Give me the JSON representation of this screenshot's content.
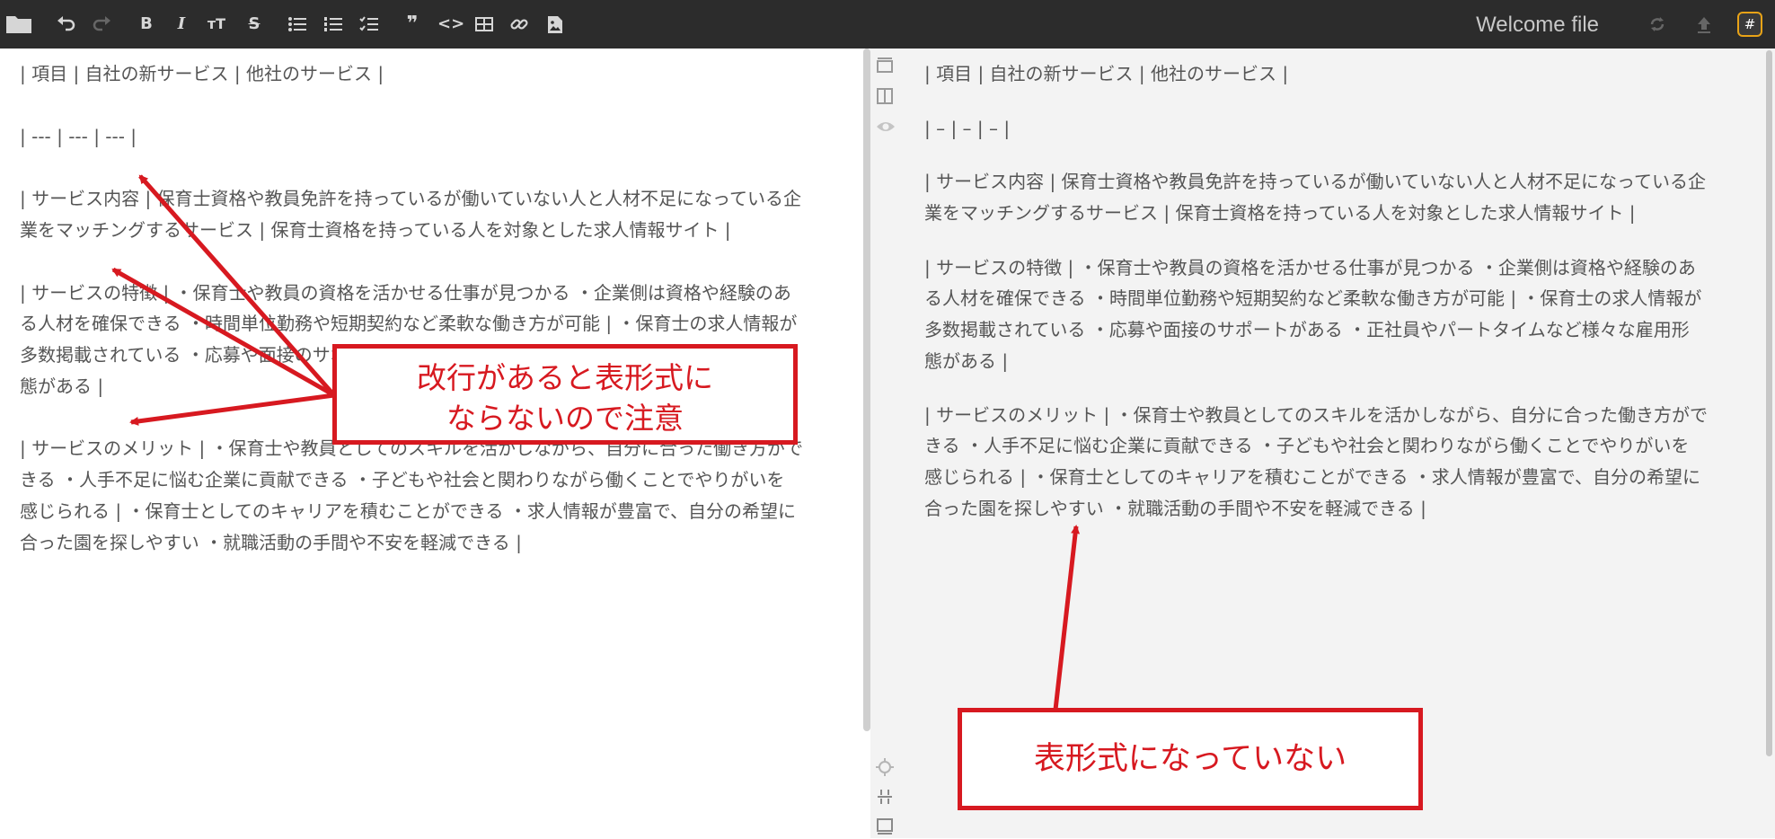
{
  "toolbar": {
    "title": "Welcome file",
    "icons": [
      "folder-icon",
      "undo-icon",
      "redo-icon",
      "bold-icon",
      "italic-icon",
      "heading-icon",
      "strikethrough-icon",
      "bullet-list-icon",
      "numbered-list-icon",
      "check-list-icon",
      "quote-icon",
      "code-icon",
      "table-icon",
      "link-icon",
      "image-icon",
      "sync-icon",
      "publish-icon",
      "workspace-icon"
    ],
    "bold_glyph": "B",
    "italic_glyph": "I",
    "heading_glyph": "ᴛT",
    "strike_glyph": "S",
    "quote_glyph": "❞",
    "code_glyph": "<>",
    "badge_glyph": "#"
  },
  "editor": {
    "lines": [
      "| 項目 | 自社の新サービス | 他社のサービス |",
      "| --- | --- | --- |",
      "| サービス内容 | 保育士資格や教員免許を持っているが働いていない人と人材不足になっている企",
      "業をマッチングするサービス | 保育士資格を持っている人を対象とした求人情報サイト |",
      "| サービスの特徴 | ・保育士や教員の資格を活かせる仕事が見つかる ・企業側は資格や経験のあ",
      "る人材を確保できる ・時間単位勤務や短期契約など柔軟な働き方が可能 | ・保育士の求人情報が",
      "多数掲載されている ・応募や面接のサポートがある ・正社員やパートタイムなど様々な雇用形",
      "態がある |",
      "| サービスのメリット | ・保育士や教員としてのスキルを活かしながら、自分に合った働き方がで",
      "きる ・人手不足に悩む企業に貢献できる ・子どもや社会と関わりながら働くことでやりがいを",
      "感じられる | ・保育士としてのキャリアを積むことができる ・求人情報が豊富で、自分の希望に",
      "合った園を探しやすい ・就職活動の手間や不安を軽減できる |"
    ]
  },
  "preview": {
    "lines": [
      "| 項目 | 自社の新サービス | 他社のサービス |",
      "| – | – | – |",
      "| サービス内容 | 保育士資格や教員免許を持っているが働いていない人と人材不足になっている企",
      "業をマッチングするサービス | 保育士資格を持っている人を対象とした求人情報サイト |",
      "| サービスの特徴 | ・保育士や教員の資格を活かせる仕事が見つかる ・企業側は資格や経験のあ",
      "る人材を確保できる ・時間単位勤務や短期契約など柔軟な働き方が可能 | ・保育士の求人情報が",
      "多数掲載されている ・応募や面接のサポートがある ・正社員やパートタイムなど様々な雇用形",
      "態がある |",
      "| サービスのメリット | ・保育士や教員としてのスキルを活かしながら、自分に合った働き方がで",
      "きる ・人手不足に悩む企業に貢献できる ・子どもや社会と関わりながら働くことでやりがいを",
      "感じられる | ・保育士としてのキャリアを積むことができる ・求人情報が豊富で、自分の希望に",
      "合った園を探しやすい ・就職活動の手間や不安を軽減できる |"
    ]
  },
  "annotations": {
    "left_line1": "改行があると表形式に",
    "left_line2": "ならないので注意",
    "right": "表形式になっていない",
    "color": "#d71920"
  },
  "colors": {
    "toolbar_bg": "#2c2c2c",
    "preview_bg": "#f3f3f3",
    "text": "#555555",
    "badge_border": "#e8a317"
  }
}
